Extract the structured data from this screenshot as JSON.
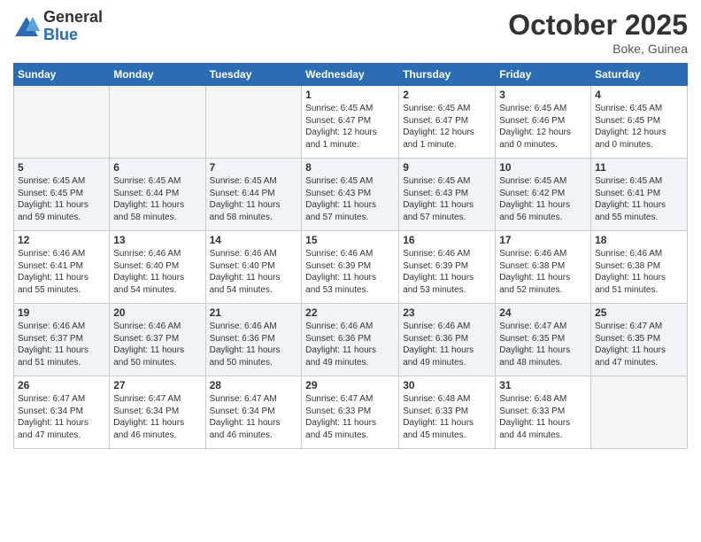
{
  "logo": {
    "general": "General",
    "blue": "Blue"
  },
  "title": "October 2025",
  "location": "Boke, Guinea",
  "days_header": [
    "Sunday",
    "Monday",
    "Tuesday",
    "Wednesday",
    "Thursday",
    "Friday",
    "Saturday"
  ],
  "weeks": [
    [
      {
        "day": "",
        "info": ""
      },
      {
        "day": "",
        "info": ""
      },
      {
        "day": "",
        "info": ""
      },
      {
        "day": "1",
        "info": "Sunrise: 6:45 AM\nSunset: 6:47 PM\nDaylight: 12 hours\nand 1 minute."
      },
      {
        "day": "2",
        "info": "Sunrise: 6:45 AM\nSunset: 6:47 PM\nDaylight: 12 hours\nand 1 minute."
      },
      {
        "day": "3",
        "info": "Sunrise: 6:45 AM\nSunset: 6:46 PM\nDaylight: 12 hours\nand 0 minutes."
      },
      {
        "day": "4",
        "info": "Sunrise: 6:45 AM\nSunset: 6:45 PM\nDaylight: 12 hours\nand 0 minutes."
      }
    ],
    [
      {
        "day": "5",
        "info": "Sunrise: 6:45 AM\nSunset: 6:45 PM\nDaylight: 11 hours\nand 59 minutes."
      },
      {
        "day": "6",
        "info": "Sunrise: 6:45 AM\nSunset: 6:44 PM\nDaylight: 11 hours\nand 58 minutes."
      },
      {
        "day": "7",
        "info": "Sunrise: 6:45 AM\nSunset: 6:44 PM\nDaylight: 11 hours\nand 58 minutes."
      },
      {
        "day": "8",
        "info": "Sunrise: 6:45 AM\nSunset: 6:43 PM\nDaylight: 11 hours\nand 57 minutes."
      },
      {
        "day": "9",
        "info": "Sunrise: 6:45 AM\nSunset: 6:43 PM\nDaylight: 11 hours\nand 57 minutes."
      },
      {
        "day": "10",
        "info": "Sunrise: 6:45 AM\nSunset: 6:42 PM\nDaylight: 11 hours\nand 56 minutes."
      },
      {
        "day": "11",
        "info": "Sunrise: 6:45 AM\nSunset: 6:41 PM\nDaylight: 11 hours\nand 55 minutes."
      }
    ],
    [
      {
        "day": "12",
        "info": "Sunrise: 6:46 AM\nSunset: 6:41 PM\nDaylight: 11 hours\nand 55 minutes."
      },
      {
        "day": "13",
        "info": "Sunrise: 6:46 AM\nSunset: 6:40 PM\nDaylight: 11 hours\nand 54 minutes."
      },
      {
        "day": "14",
        "info": "Sunrise: 6:46 AM\nSunset: 6:40 PM\nDaylight: 11 hours\nand 54 minutes."
      },
      {
        "day": "15",
        "info": "Sunrise: 6:46 AM\nSunset: 6:39 PM\nDaylight: 11 hours\nand 53 minutes."
      },
      {
        "day": "16",
        "info": "Sunrise: 6:46 AM\nSunset: 6:39 PM\nDaylight: 11 hours\nand 53 minutes."
      },
      {
        "day": "17",
        "info": "Sunrise: 6:46 AM\nSunset: 6:38 PM\nDaylight: 11 hours\nand 52 minutes."
      },
      {
        "day": "18",
        "info": "Sunrise: 6:46 AM\nSunset: 6:38 PM\nDaylight: 11 hours\nand 51 minutes."
      }
    ],
    [
      {
        "day": "19",
        "info": "Sunrise: 6:46 AM\nSunset: 6:37 PM\nDaylight: 11 hours\nand 51 minutes."
      },
      {
        "day": "20",
        "info": "Sunrise: 6:46 AM\nSunset: 6:37 PM\nDaylight: 11 hours\nand 50 minutes."
      },
      {
        "day": "21",
        "info": "Sunrise: 6:46 AM\nSunset: 6:36 PM\nDaylight: 11 hours\nand 50 minutes."
      },
      {
        "day": "22",
        "info": "Sunrise: 6:46 AM\nSunset: 6:36 PM\nDaylight: 11 hours\nand 49 minutes."
      },
      {
        "day": "23",
        "info": "Sunrise: 6:46 AM\nSunset: 6:36 PM\nDaylight: 11 hours\nand 49 minutes."
      },
      {
        "day": "24",
        "info": "Sunrise: 6:47 AM\nSunset: 6:35 PM\nDaylight: 11 hours\nand 48 minutes."
      },
      {
        "day": "25",
        "info": "Sunrise: 6:47 AM\nSunset: 6:35 PM\nDaylight: 11 hours\nand 47 minutes."
      }
    ],
    [
      {
        "day": "26",
        "info": "Sunrise: 6:47 AM\nSunset: 6:34 PM\nDaylight: 11 hours\nand 47 minutes."
      },
      {
        "day": "27",
        "info": "Sunrise: 6:47 AM\nSunset: 6:34 PM\nDaylight: 11 hours\nand 46 minutes."
      },
      {
        "day": "28",
        "info": "Sunrise: 6:47 AM\nSunset: 6:34 PM\nDaylight: 11 hours\nand 46 minutes."
      },
      {
        "day": "29",
        "info": "Sunrise: 6:47 AM\nSunset: 6:33 PM\nDaylight: 11 hours\nand 45 minutes."
      },
      {
        "day": "30",
        "info": "Sunrise: 6:48 AM\nSunset: 6:33 PM\nDaylight: 11 hours\nand 45 minutes."
      },
      {
        "day": "31",
        "info": "Sunrise: 6:48 AM\nSunset: 6:33 PM\nDaylight: 11 hours\nand 44 minutes."
      },
      {
        "day": "",
        "info": ""
      }
    ]
  ]
}
